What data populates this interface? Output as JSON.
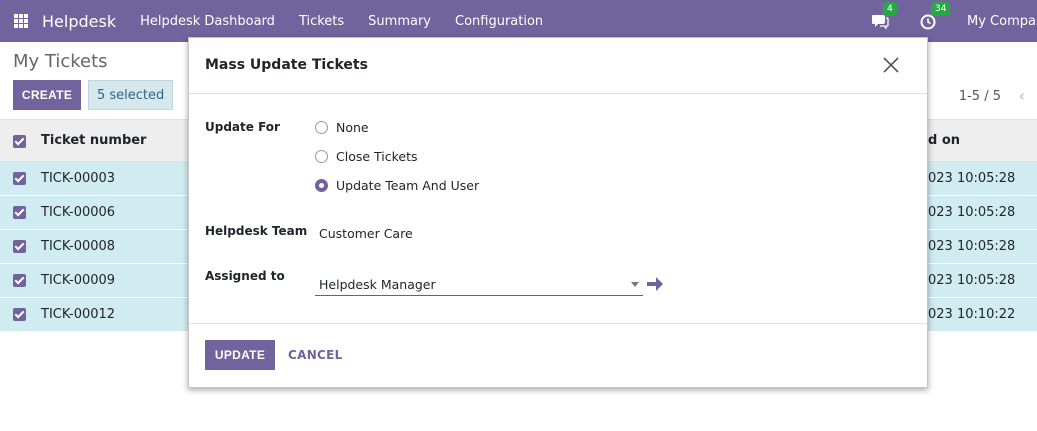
{
  "navbar": {
    "brand": "Helpdesk",
    "menu": [
      "Helpdesk Dashboard",
      "Tickets",
      "Summary",
      "Configuration"
    ],
    "messages_count": "4",
    "activities_count": "34",
    "company": "My Company"
  },
  "control_panel": {
    "breadcrumb": "My Tickets",
    "create_label": "CREATE",
    "selected_label": "5 selected",
    "pager": "1-5 / 5"
  },
  "list": {
    "headers": {
      "ticket": "Ticket number",
      "date": "d on"
    },
    "rows": [
      {
        "ticket": "TICK-00003",
        "date": "023 10:05:28"
      },
      {
        "ticket": "TICK-00006",
        "date": "023 10:05:28"
      },
      {
        "ticket": "TICK-00008",
        "date": "023 10:05:28"
      },
      {
        "ticket": "TICK-00009",
        "date": "023 10:05:28"
      },
      {
        "ticket": "TICK-00012",
        "date": "023 10:10:22"
      }
    ]
  },
  "modal": {
    "title": "Mass Update Tickets",
    "update_for_label": "Update For",
    "options": [
      "None",
      "Close Tickets",
      "Update Team And User"
    ],
    "selected_option": "Update Team And User",
    "team_label": "Helpdesk Team",
    "team_value": "Customer Care",
    "assigned_label": "Assigned to",
    "assigned_value": "Helpdesk Manager",
    "update_button": "UPDATE",
    "cancel_button": "CANCEL"
  },
  "colors": {
    "primary": "#71639e",
    "selected_row": "#d1ecf1",
    "badge": "#28a745"
  }
}
